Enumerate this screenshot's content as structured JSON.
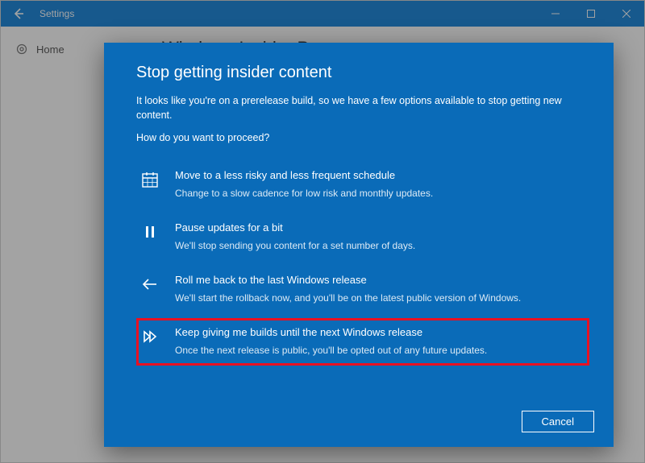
{
  "window": {
    "title": "Settings"
  },
  "sidebar": {
    "home_label": "Home"
  },
  "page": {
    "heading": "Windows Insider Program"
  },
  "dialog": {
    "title": "Stop getting insider content",
    "intro": "It looks like you're on a prerelease build, so we have a few options available to stop getting new content.",
    "question": "How do you want to proceed?",
    "options": [
      {
        "title": "Move to a less risky and less frequent schedule",
        "desc": "Change to a slow cadence for low risk and monthly updates."
      },
      {
        "title": "Pause updates for a bit",
        "desc": "We'll stop sending you content for a set number of days."
      },
      {
        "title": "Roll me back to the last Windows release",
        "desc": "We'll start the rollback now, and you'll be on the latest public version of Windows."
      },
      {
        "title": "Keep giving me builds until the next Windows release",
        "desc": "Once the next release is public, you'll be opted out of any future updates."
      }
    ],
    "cancel_label": "Cancel"
  },
  "colors": {
    "accent": "#0078d7",
    "dialog_bg": "#0a6bb8",
    "highlight": "#e81123"
  }
}
